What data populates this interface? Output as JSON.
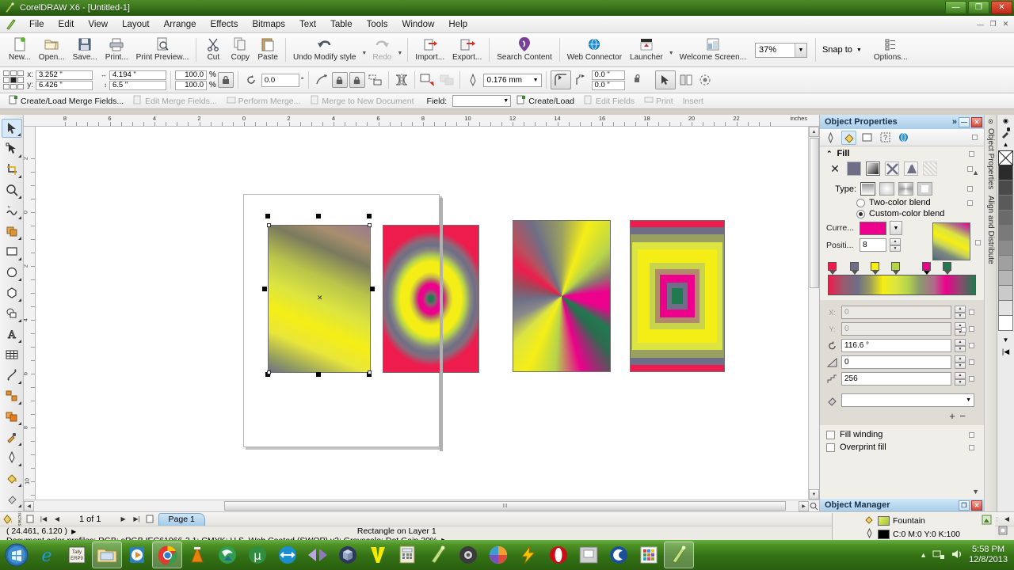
{
  "window": {
    "title": "CorelDRAW X6 - [Untitled-1]",
    "minimize": "—",
    "maximize": "❐",
    "close": "✕",
    "doc_minimize": "—",
    "doc_restore": "❐",
    "doc_close": "✕"
  },
  "menu": {
    "items": [
      "File",
      "Edit",
      "View",
      "Layout",
      "Arrange",
      "Effects",
      "Bitmaps",
      "Text",
      "Table",
      "Tools",
      "Window",
      "Help"
    ]
  },
  "standard_toolbar": {
    "items": [
      {
        "label": "New...",
        "icon": "new-document-icon",
        "dim": false
      },
      {
        "label": "Open...",
        "icon": "open-folder-icon",
        "dim": false
      },
      {
        "label": "Save...",
        "icon": "save-disk-icon",
        "dim": false
      },
      {
        "label": "Print...",
        "icon": "printer-icon",
        "dim": false
      },
      {
        "label": "Print Preview...",
        "icon": "print-preview-icon",
        "dim": false
      },
      {
        "label": "Cut",
        "icon": "scissors-icon",
        "dim": false
      },
      {
        "label": "Copy",
        "icon": "copy-icon",
        "dim": false
      },
      {
        "label": "Paste",
        "icon": "paste-icon",
        "dim": false
      },
      {
        "label": "Undo Modify style",
        "icon": "undo-arrow-icon",
        "dim": false
      },
      {
        "label": "Redo",
        "icon": "redo-arrow-icon",
        "dim": true
      },
      {
        "label": "Import...",
        "icon": "import-icon",
        "dim": false
      },
      {
        "label": "Export...",
        "icon": "export-icon",
        "dim": false
      },
      {
        "label": "Search Content",
        "icon": "search-content-icon",
        "dim": false
      },
      {
        "label": "Web Connector",
        "icon": "globe-icon",
        "dim": false
      },
      {
        "label": "Launcher",
        "icon": "launcher-icon",
        "dim": false
      },
      {
        "label": "Welcome Screen...",
        "icon": "welcome-screen-icon",
        "dim": false
      }
    ],
    "zoom_level": "37%",
    "snap_to_label": "Snap to",
    "options_label": "Options..."
  },
  "property_bar": {
    "x_label": "x:",
    "x_value": "3.252 \"",
    "y_label": "y:",
    "y_value": "6.426 \"",
    "width_value": "4.194 \"",
    "height_value": "6.5 \"",
    "scale_h": "100.0",
    "scale_v": "100.0",
    "percent_sign": "%",
    "rotation_value": "0.0",
    "rotation_unit": "°",
    "outline_width": "0.176 mm",
    "corner_a": "0.0 \"",
    "corner_b": "0.0 \""
  },
  "merge_bar": {
    "items": [
      {
        "label": "Create/Load Merge Fields...",
        "dim": false
      },
      {
        "label": "Edit Merge Fields...",
        "dim": true
      },
      {
        "label": "Perform Merge...",
        "dim": true
      },
      {
        "label": "Merge to New Document",
        "dim": true
      }
    ],
    "field_label": "Field:",
    "field_value": "",
    "right_items": [
      {
        "label": "Create/Load",
        "dim": false
      },
      {
        "label": "Edit Fields",
        "dim": true
      },
      {
        "label": "Print",
        "dim": true
      },
      {
        "label": "Insert",
        "dim": true
      }
    ]
  },
  "toolbox": {
    "tools": [
      {
        "name": "pick-tool",
        "selected": true
      },
      {
        "name": "shape-tool",
        "selected": false
      },
      {
        "name": "crop-tool",
        "selected": false
      },
      {
        "name": "zoom-tool",
        "selected": false
      },
      {
        "name": "freehand-tool",
        "selected": false
      },
      {
        "name": "smart-fill-tool",
        "selected": false
      },
      {
        "name": "rectangle-tool",
        "selected": false
      },
      {
        "name": "ellipse-tool",
        "selected": false
      },
      {
        "name": "polygon-tool",
        "selected": false
      },
      {
        "name": "basic-shapes-tool",
        "selected": false
      },
      {
        "name": "text-tool",
        "selected": false
      },
      {
        "name": "table-tool",
        "selected": false
      },
      {
        "name": "dimension-tool",
        "selected": false
      },
      {
        "name": "connector-tool",
        "selected": false
      },
      {
        "name": "blend-tool",
        "selected": false
      },
      {
        "name": "color-eyedropper-tool",
        "selected": false
      },
      {
        "name": "outline-pen-tool",
        "selected": false
      },
      {
        "name": "fill-tool",
        "selected": false
      },
      {
        "name": "interactive-fill-tool",
        "selected": false
      }
    ]
  },
  "rulers": {
    "h_labels": [
      "8",
      "6",
      "4",
      "2",
      "0",
      "2",
      "4",
      "6",
      "8",
      "10",
      "12",
      "14",
      "16",
      "18",
      "20",
      "22"
    ],
    "unit": "inches",
    "v_labels": [
      "2",
      "0",
      "2",
      "4",
      "6",
      "8",
      "10"
    ],
    "unit_corner": "inches"
  },
  "canvas": {
    "objects": [
      {
        "name": "linear-gradient-rectangle",
        "type": "linear",
        "selected": true
      },
      {
        "name": "radial-gradient-rectangle",
        "type": "radial",
        "selected": false
      },
      {
        "name": "conical-gradient-rectangle",
        "type": "conical",
        "selected": false
      },
      {
        "name": "square-gradient-rectangle",
        "type": "square",
        "selected": false
      }
    ],
    "gradient_colors": [
      "#ee1c4c",
      "#6e6f86",
      "#f5ee16",
      "#b5d44b",
      "#ec008c",
      "#1f7a4f"
    ],
    "scroll_thumb_glyph": "III"
  },
  "docker": {
    "title": "Object Properties",
    "expand_glyph": "»",
    "side_tab_1": "Object Properties",
    "side_tab_2": "Align and Distribute",
    "tabs": [
      {
        "name": "outline-tab",
        "active": false
      },
      {
        "name": "fill-tab",
        "active": true
      },
      {
        "name": "rectangle-tab",
        "active": false
      },
      {
        "name": "summary-tab",
        "active": false
      },
      {
        "name": "internet-tab",
        "active": false
      }
    ],
    "fill": {
      "section_label": "Fill",
      "buttons": [
        {
          "name": "no-fill-button",
          "active": false
        },
        {
          "name": "uniform-fill-button",
          "active": false
        },
        {
          "name": "fountain-fill-button",
          "active": true
        },
        {
          "name": "pattern-fill-button",
          "active": false
        },
        {
          "name": "texture-fill-button",
          "active": false
        },
        {
          "name": "postscript-fill-button",
          "active": false
        }
      ],
      "type_label": "Type:",
      "types": [
        {
          "name": "linear-type",
          "active": true
        },
        {
          "name": "radial-type",
          "active": false
        },
        {
          "name": "conical-type",
          "active": false
        },
        {
          "name": "square-type",
          "active": false
        }
      ],
      "two_color_blend": "Two-color blend",
      "custom_color_blend": "Custom-color blend",
      "blend_selected": "custom",
      "current_label": "Curre...",
      "current_color": "#ec008c",
      "position_label": "Positi...",
      "position_value": "8",
      "node_colors": [
        "#ee1c4c",
        "#6e6f86",
        "#f5ee16",
        "#b5d44b",
        "#ec008c",
        "#1f7a4f"
      ],
      "node_positions": [
        0,
        20,
        37,
        54,
        80,
        97
      ],
      "selected_node_index": 4
    },
    "transform": {
      "x_label": "X:",
      "x_value": "0",
      "y_label": "Y:",
      "y_value": "0",
      "angle_value": "116.6 °",
      "edge_pad_value": "0",
      "steps_value": "256",
      "preset_value": ""
    },
    "add_remove": "+ −",
    "checkboxes": [
      {
        "label": "Fill winding",
        "checked": false
      },
      {
        "label": "Overprint fill",
        "checked": false
      }
    ]
  },
  "object_manager": {
    "title": "Object Manager",
    "rows": [
      {
        "icon": "fill-icon",
        "swatch": "#d4e24a",
        "label": "Fountain"
      },
      {
        "icon": "outline-icon",
        "swatch": "#000000",
        "label": "C:0 M:0 Y:0 K:100"
      }
    ]
  },
  "status_bar": {
    "page_current": "1 of 1",
    "page_tab": "Page 1",
    "coordinates": "( 24.461, 6.120  )",
    "selection_info": "Rectangle on Layer 1",
    "color_profiles": "Document color profiles: RGB: sRGB IEC61966-2.1; CMYK: U.S. Web Coated (SWOP) v2; Grayscale: Dot Gain 20%",
    "arrow_glyph": "▶"
  },
  "palette": {
    "swatches": [
      "#000000",
      "#1a1a1a",
      "#333333",
      "#4d4d4d",
      "#666666",
      "#808080",
      "#999999",
      "#b3b3b3",
      "#cccccc",
      "#e6e6e6",
      "#ffffff"
    ],
    "none_label": "none"
  },
  "taskbar": {
    "items": [
      {
        "name": "start-button",
        "active": false
      },
      {
        "name": "internet-explorer-icon",
        "active": false
      },
      {
        "name": "tally-erp9-icon",
        "active": false
      },
      {
        "name": "windows-explorer-icon",
        "active": true
      },
      {
        "name": "media-player-icon",
        "active": false
      },
      {
        "name": "google-chrome-icon",
        "active": true
      },
      {
        "name": "vlc-player-icon",
        "active": false
      },
      {
        "name": "internet-download-manager-icon",
        "active": false
      },
      {
        "name": "utorrent-icon",
        "active": false
      },
      {
        "name": "teamviewer-icon",
        "active": false
      },
      {
        "name": "kmplayer-icon",
        "active": false
      },
      {
        "name": "virtualbox-icon",
        "active": false
      },
      {
        "name": "vegas-icon",
        "active": false
      },
      {
        "name": "calculator-icon",
        "active": false
      },
      {
        "name": "coreldraw-icon",
        "active": false
      },
      {
        "name": "photo-viewer-icon",
        "active": false
      },
      {
        "name": "picasa-icon",
        "active": false
      },
      {
        "name": "winamp-icon",
        "active": false
      },
      {
        "name": "opera-icon",
        "active": false
      },
      {
        "name": "printer-icon",
        "active": false
      },
      {
        "name": "ccleaner-icon",
        "active": false
      },
      {
        "name": "app-grid-icon",
        "active": false
      },
      {
        "name": "coreldraw-active-icon",
        "active": true
      }
    ],
    "tray_expand": "▲",
    "time": "5:58 PM",
    "date": "12/8/2013"
  }
}
